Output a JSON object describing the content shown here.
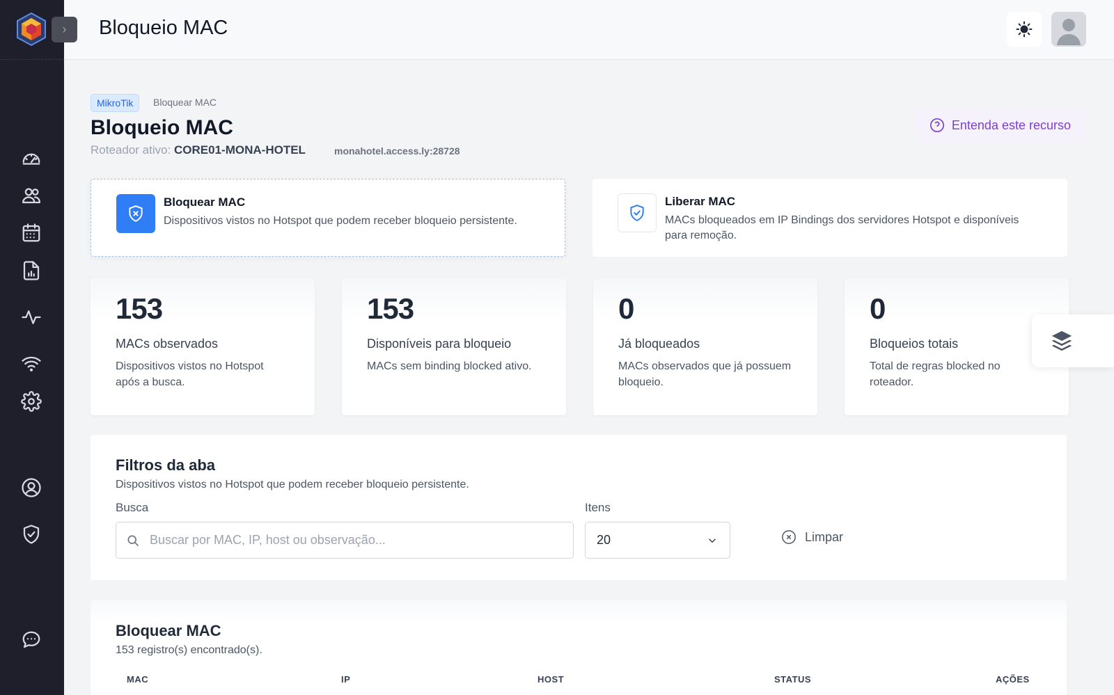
{
  "header": {
    "title": "Bloqueio MAC"
  },
  "sidebar": {
    "items": [
      {
        "icon": "dashboard-gauge-icon"
      },
      {
        "icon": "users-icon"
      },
      {
        "icon": "calendar-icon"
      },
      {
        "icon": "report-icon"
      },
      {
        "icon": "activity-icon"
      },
      {
        "icon": "wifi-icon"
      },
      {
        "icon": "settings-icon"
      },
      {
        "icon": "user-circle-icon"
      },
      {
        "icon": "shield-check-icon"
      },
      {
        "icon": "chat-icon"
      }
    ]
  },
  "breadcrumb": {
    "badge": "MikroTik",
    "current": "Bloquear MAC"
  },
  "page": {
    "title": "Bloqueio MAC",
    "router_label": "Roteador ativo:",
    "router_name": "CORE01-MONA-HOTEL",
    "router_host": "monahotel.access.ly:28728",
    "help_label": "Entenda este recurso"
  },
  "modes": [
    {
      "title": "Bloquear MAC",
      "description": "Dispositivos vistos no Hotspot que podem receber bloqueio persistente."
    },
    {
      "title": "Liberar MAC",
      "description": "MACs bloqueados em IP Bindings dos servidores Hotspot e disponíveis para remoção."
    }
  ],
  "stats": [
    {
      "value": "153",
      "label": "MACs observados",
      "description": "Dispositivos vistos no Hotspot após a busca."
    },
    {
      "value": "153",
      "label": "Disponíveis para bloqueio",
      "description": "MACs sem binding blocked ativo."
    },
    {
      "value": "0",
      "label": "Já bloqueados",
      "description": "MACs observados que já possuem bloqueio."
    },
    {
      "value": "0",
      "label": "Bloqueios totais",
      "description": "Total de regras blocked no roteador."
    }
  ],
  "filters": {
    "title": "Filtros da aba",
    "subtitle": "Dispositivos vistos no Hotspot que podem receber bloqueio persistente.",
    "search_label": "Busca",
    "search_placeholder": "Buscar por MAC, IP, host ou observação...",
    "search_value": "",
    "items_label": "Itens",
    "items_value": "20",
    "clear_label": "Limpar"
  },
  "table": {
    "title": "Bloquear MAC",
    "subtitle": "153 registro(s) encontrado(s).",
    "columns": [
      "MAC",
      "IP",
      "HOST",
      "STATUS",
      "AÇÕES"
    ]
  },
  "colors": {
    "sidebar_bg": "#1e1f2b",
    "accent_blue": "#2f7ef5",
    "accent_purple": "#7e3fd0"
  }
}
